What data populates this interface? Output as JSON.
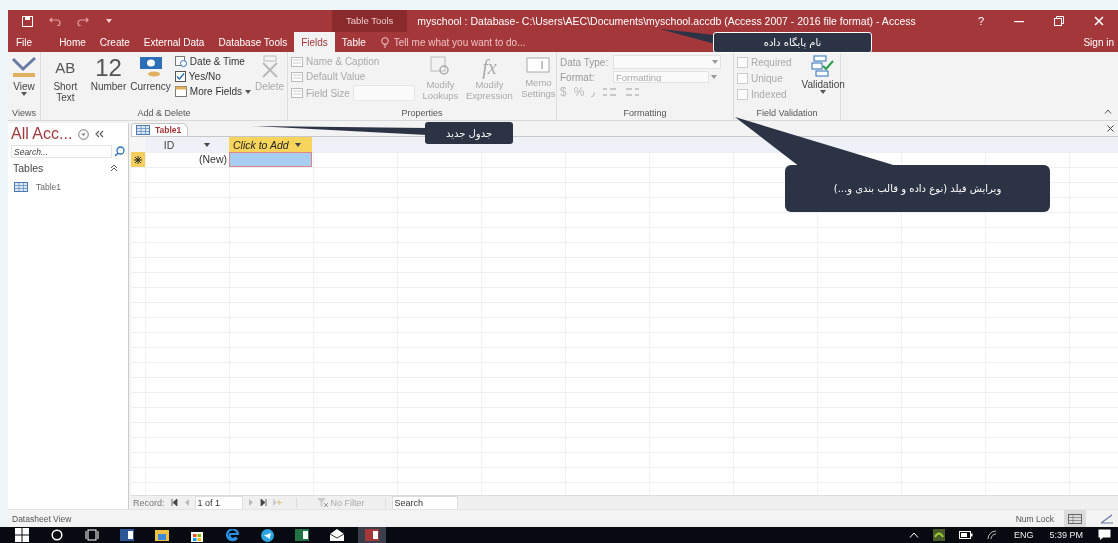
{
  "title_bar": {
    "context_label": "Table Tools",
    "title": "myschool : Database- C:\\Users\\AEC\\Documents\\myschool.accdb (Access 2007 - 2016 file format) - Access",
    "help": "?"
  },
  "ribbon_tabs": [
    {
      "label": "File",
      "selected": false
    },
    {
      "label": "Home",
      "selected": false
    },
    {
      "label": "Create",
      "selected": false
    },
    {
      "label": "External Data",
      "selected": false
    },
    {
      "label": "Database Tools",
      "selected": false
    },
    {
      "label": "Fields",
      "selected": true
    },
    {
      "label": "Table",
      "selected": false
    }
  ],
  "tell_me": {
    "placeholder": "Tell me what you want to do..."
  },
  "sign_in": "Sign in",
  "ribbon": {
    "views": {
      "label": "Views",
      "view_button": "View"
    },
    "add_delete": {
      "label": "Add & Delete",
      "short_text": {
        "glyph": "AB",
        "label": "Short Text"
      },
      "number": {
        "glyph": "12",
        "label": "Number"
      },
      "currency": "Currency",
      "date_time": "Date & Time",
      "yes_no": "Yes/No",
      "more_fields": "More Fields",
      "delete": {
        "label": "Delete",
        "disabled": true
      }
    },
    "properties": {
      "label": "Properties",
      "small": [
        {
          "label": "Name & Caption",
          "disabled": true
        },
        {
          "label": "Default Value",
          "disabled": true
        },
        {
          "label": "Field Size",
          "disabled": true
        }
      ],
      "large": [
        {
          "label": "Modify Lookups",
          "disabled": true
        },
        {
          "label": "Modify Expression",
          "glyph": "fx",
          "disabled": true
        },
        {
          "label": "Memo Settings",
          "disabled": true
        }
      ]
    },
    "formatting": {
      "label": "Formatting",
      "data_type": "Data Type:",
      "format": "Format:",
      "format_placeholder": "Formatting",
      "symbols": [
        "$",
        "%",
        "٫"
      ],
      "disabled": true
    },
    "field_validation": {
      "label": "Field Validation",
      "checks": [
        {
          "label": "Required",
          "disabled": true
        },
        {
          "label": "Unique",
          "disabled": true
        },
        {
          "label": "Indexed",
          "disabled": true
        }
      ],
      "validation": "Validation"
    }
  },
  "nav_pane": {
    "title": "All Acc...",
    "search_placeholder": "Search...",
    "section": "Tables",
    "items": [
      {
        "label": "Table1"
      }
    ]
  },
  "document_tab": {
    "label": "Table1"
  },
  "table": {
    "columns": [
      "ID",
      "Click to Add"
    ],
    "new_row": "(New)"
  },
  "record_bar": {
    "label": "Record:",
    "position": "1 of 1",
    "filter": "No Filter",
    "search_placeholder": "Search"
  },
  "status_bar": {
    "view": "Datasheet View",
    "num_lock": "Num Lock"
  },
  "taskbar": {
    "apps": [
      {
        "kind": "start",
        "selected": false
      },
      {
        "kind": "search",
        "selected": false
      },
      {
        "kind": "taskview",
        "selected": false
      },
      {
        "kind": "word",
        "selected": false
      },
      {
        "kind": "folder",
        "selected": false
      },
      {
        "kind": "store",
        "selected": false
      },
      {
        "kind": "edge",
        "selected": false
      },
      {
        "kind": "telegram",
        "selected": false
      },
      {
        "kind": "excel",
        "selected": false
      },
      {
        "kind": "mail",
        "selected": false
      },
      {
        "kind": "access",
        "selected": true
      }
    ],
    "language": "ENG",
    "time": "5:39 PM"
  },
  "callouts": [
    {
      "text": "نام پایگاه داده"
    },
    {
      "text": "جدول جدید"
    },
    {
      "text": "ویرایش فیلد (نوع داده و قالب بندی و...)"
    }
  ]
}
